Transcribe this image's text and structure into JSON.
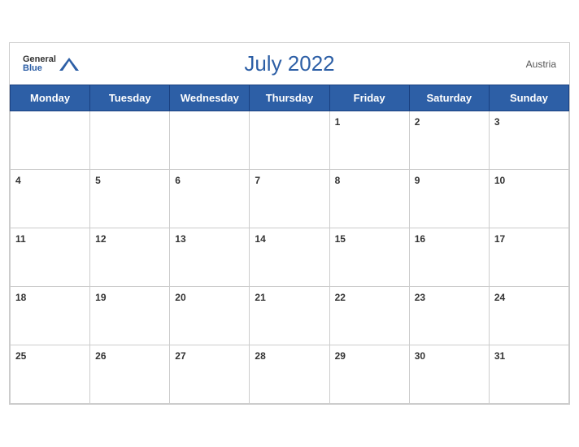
{
  "header": {
    "title": "July 2022",
    "country": "Austria",
    "logo_general": "General",
    "logo_blue": "Blue"
  },
  "days_of_week": [
    "Monday",
    "Tuesday",
    "Wednesday",
    "Thursday",
    "Friday",
    "Saturday",
    "Sunday"
  ],
  "weeks": [
    [
      null,
      null,
      null,
      null,
      1,
      2,
      3
    ],
    [
      4,
      5,
      6,
      7,
      8,
      9,
      10
    ],
    [
      11,
      12,
      13,
      14,
      15,
      16,
      17
    ],
    [
      18,
      19,
      20,
      21,
      22,
      23,
      24
    ],
    [
      25,
      26,
      27,
      28,
      29,
      30,
      31
    ]
  ]
}
